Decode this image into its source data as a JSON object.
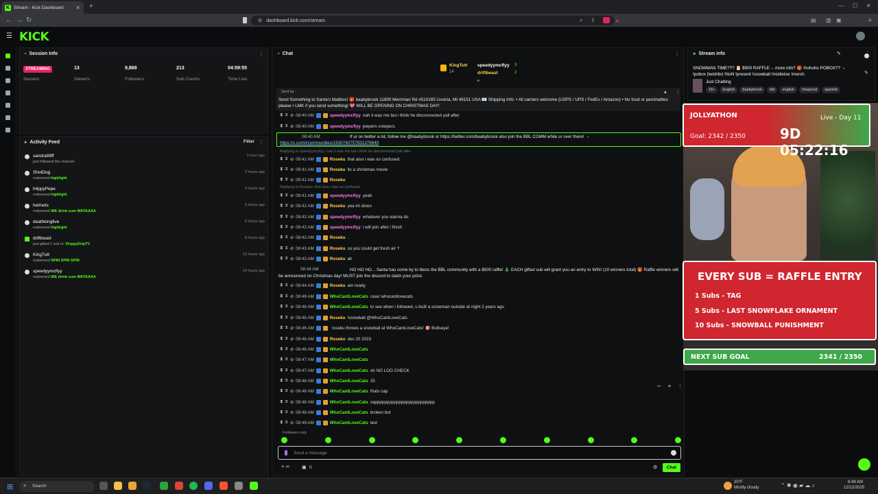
{
  "browser": {
    "tab_title": "Stream - Kick Dashboard",
    "url": "dashboard.kick.com/stream"
  },
  "app": {
    "logo": "KICK"
  },
  "session": {
    "title": "Session Info",
    "status": "STREAMING",
    "session_label": "Session",
    "stats": [
      {
        "value": "13",
        "label": "Viewers"
      },
      {
        "value": "9,869",
        "label": "Followers"
      },
      {
        "value": "213",
        "label": "Sub Counts"
      },
      {
        "value": "04:59:55",
        "label": "Time Live"
      }
    ]
  },
  "activity": {
    "title": "Activity Feed",
    "filter_label": "Filter",
    "items": [
      {
        "name": "sandra99ff",
        "desc": "just followed the channel",
        "hl": "",
        "time": "1 hour ago"
      },
      {
        "name": "ShotDog",
        "desc": "redeemed ",
        "hl": "highlight",
        "time": "3 hours ago"
      },
      {
        "name": "h4ppyPepe",
        "desc": "redeemed ",
        "hl": "highlight",
        "time": "4 hours ago"
      },
      {
        "name": "helmets",
        "desc": "redeemed ",
        "hl": "WE drink sum WATAAAA",
        "time": "5 hours ago"
      },
      {
        "name": "deathkingfive",
        "desc": "redeemed ",
        "hl": "highlight",
        "time": "6 hours ago"
      },
      {
        "name": "driftbeast",
        "desc": "just gifted 1 sub to: ",
        "hl": "DrippyDripTV",
        "time": "8 hours ago"
      },
      {
        "name": "KingTutt",
        "desc": "redeemed ",
        "hl": "SPIN SPIN SPIN",
        "time": "12 hours ago"
      },
      {
        "name": "speedyymcflyy",
        "desc": "redeemed ",
        "hl": "WE drink sum WATAAAA",
        "time": "14 hours ago"
      }
    ]
  },
  "chat": {
    "title": "Chat",
    "leaders": [
      {
        "name": "KingTutt",
        "count": "14"
      },
      {
        "name": "speedyymcflyy",
        "count": "3"
      },
      {
        "name": "driftbeast",
        "count": "2"
      }
    ],
    "pinned": {
      "sent_by": "Sent by",
      "text": "Send Something to Santa's Mailbox! 🎁 baabybrook 11800 Merriman Rd #510165 Livonia, MI 48151 USA 📧 Shipping Info: • All carriers welcome (USPS / UPS / FedEx / Amazon) • No food or perishables please • LMK if you send something! 💖 WILL BE OPENING ON CHRISTMAS DAY!"
    },
    "messages": [
      {
        "time": "08:40 AM",
        "user": "speedyymcflyy",
        "color": "#ff7ce6",
        "text": "nah it was me but i think he disconnected yall after"
      },
      {
        "time": "08:40 AM",
        "user": "speedyymcflyy",
        "color": "#ff7ce6",
        "text": "jeepers creepers"
      },
      {
        "time": "08:41 AM",
        "user": "Roseku",
        "color": "#ffd54a",
        "text": "that also i was so confused"
      },
      {
        "time": "08:41 AM",
        "user": "Roseku",
        "color": "#ffd54a",
        "text": "its a christmas movie"
      },
      {
        "time": "08:41 AM",
        "user": "Roseku",
        "color": "#ffd54a",
        "text": ""
      },
      {
        "time": "08:41 AM",
        "user": "speedyymcflyy",
        "color": "#ff7ce6",
        "text": "yeah"
      },
      {
        "time": "08:42 AM",
        "user": "Roseku",
        "color": "#ffd54a",
        "text": "yea im down"
      },
      {
        "time": "08:42 AM",
        "user": "speedyymcflyy",
        "color": "#ff7ce6",
        "text": "whatever you wanna do"
      },
      {
        "time": "08:42 AM",
        "user": "speedyymcflyy",
        "color": "#ff7ce6",
        "text": "i will join after i finish"
      },
      {
        "time": "08:42 AM",
        "user": "Roseku",
        "color": "#ffd54a",
        "text": "."
      },
      {
        "time": "08:43 AM",
        "user": "Roseku",
        "color": "#ffd54a",
        "text": "so you could get fresh air ?"
      },
      {
        "time": "08:43 AM",
        "user": "Roseku",
        "color": "#ffd54a",
        "text": "ah"
      },
      {
        "time": "08:44 AM",
        "user": "Roseku",
        "color": "#ffd54a",
        "text": "am ready"
      },
      {
        "time": "08:46 AM",
        "user": "WhoCantLoveCats",
        "color": "#53fc18",
        "text": "/user whocantlovecats"
      },
      {
        "time": "08:46 AM",
        "user": "WhoCantLoveCats",
        "color": "#53fc18",
        "text": "to see when i followed, u built a snowman outside at night 2 years ago"
      },
      {
        "time": "08:46 AM",
        "user": "Roseku",
        "color": "#ffd54a",
        "text": "!snowball @WhoCantLoveCats"
      },
      {
        "time": "08:46 AM",
        "user": "",
        "color": "#e0245e",
        "text": "roseku throws a snowball at WhoCantLoveCats! 🎯 Bullseye!"
      },
      {
        "time": "08:46 AM",
        "user": "Roseku",
        "color": "#ffd54a",
        "text": "dec 20 2023"
      },
      {
        "time": "08:46 AM",
        "user": "WhoCantLoveCats",
        "color": "#53fc18",
        "text": ""
      },
      {
        "time": "08:47 AM",
        "user": "WhoCantLoveCats",
        "color": "#53fc18",
        "text": ""
      },
      {
        "time": "08:47 AM",
        "user": "WhoCantLoveCats",
        "color": "#53fc18",
        "text": "oh NO LOG CHECK"
      },
      {
        "time": "08:48 AM",
        "user": "WhoCantLoveCats",
        "color": "#53fc18",
        "text": "25"
      },
      {
        "time": "08:48 AM",
        "user": "WhoCantLoveCats",
        "color": "#53fc18",
        "text": "thats cap"
      },
      {
        "time": "08:48 AM",
        "user": "WhoCantLoveCats",
        "color": "#53fc18",
        "text": "cappppppppppppppppppppppppp"
      },
      {
        "time": "08:48 AM",
        "user": "WhoCantLoveCats",
        "color": "#53fc18",
        "text": "broken bot"
      },
      {
        "time": "08:49 AM",
        "user": "WhoCantLoveCats",
        "color": "#53fc18",
        "text": "test"
      }
    ],
    "special": {
      "twitter_time": "08:40 AM",
      "twitter_text": "If ur on twitter a lot, follow me @baabybrook or https://twitter.com/baabybrook also join the BBL COMM while ur over there! →",
      "twitter_link": "https://x.com/i/communities/1930740757831376640",
      "reply1": "Replying to speedyymcflyy: nah it was me but i think he disconnected yall after",
      "reply2": "Replying to Roseku: that also i was so confused",
      "raffle_time": "08:44 AM",
      "raffle_text": "HO HO HO... Santa has come by to bless the BBL community with a $500 raffle! 🎄 EACH gifted sub will grant you an entry to WIN! (10 winners total) 🎁 Raffle winners will be announced on Christmas day! MUST join the discord to claim your prize."
    },
    "followers_only": "Followers only",
    "input_placeholder": "Send a message",
    "send_label": "Chat",
    "footer_count": "0"
  },
  "stream_info": {
    "title": "Stream info",
    "stream_title": "SNOWMAN TIME??? 🎅 $500 RAFFLE→ more info? 🎁 !hohoho POBOX?? → !pobox |!wishlist !NoN !present !snowball !mistletoe !merch",
    "category": "Just Chatting",
    "tags": [
      "18+",
      "English",
      "baabybrook",
      "bbl",
      "english",
      "!mupexst",
      "spanish"
    ]
  },
  "overlay": {
    "event_name": "JOLLYATHON",
    "live_day": "Live - Day 11",
    "goal": "Goal: 2342 / 2350",
    "timer": "9D 05:22:16",
    "raffle_title": "EVERY SUB = RAFFLE ENTRY",
    "raffle_lines": [
      "1 Subs - TAG",
      "5 Subs - LAST SNOWFLAKE ORNAMENT",
      "10 Subs - SNOWBALL PUNISHMENT"
    ],
    "next_goal_label": "NEXT SUB GOAL",
    "next_goal_value": "2341 / 2350"
  },
  "taskbar": {
    "search": "Search",
    "weather_temp": "20°F",
    "weather_desc": "Mostly cloudy",
    "time": "8:49 AM",
    "date": "12/12/2025"
  },
  "colors": {
    "accent": "#53fc18",
    "streaming": "#e0245e",
    "overlay_red": "#d0262f"
  }
}
